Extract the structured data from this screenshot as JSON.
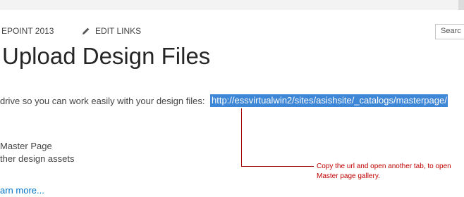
{
  "header": {
    "site_name": "EPOINT 2013",
    "edit_links": "EDIT LINKS",
    "edit_icon": "pencil-icon",
    "search_placeholder": "Searc"
  },
  "page": {
    "title": "Upload Design Files",
    "description": "drive so you can work easily with your design files:",
    "url": "http://essvirtualwin2/sites/asishsite/_catalogs/masterpage/"
  },
  "list": {
    "items": [
      {
        "label": "Master Page"
      },
      {
        "label": "ther design assets"
      }
    ]
  },
  "learn_more": "arn more...",
  "annotation": {
    "text": "Copy the url and open another tab, to open Master page gallery.",
    "color": "#c00000"
  },
  "colors": {
    "selection": "#3e86d6",
    "link": "#0072c6",
    "title": "#262626"
  }
}
